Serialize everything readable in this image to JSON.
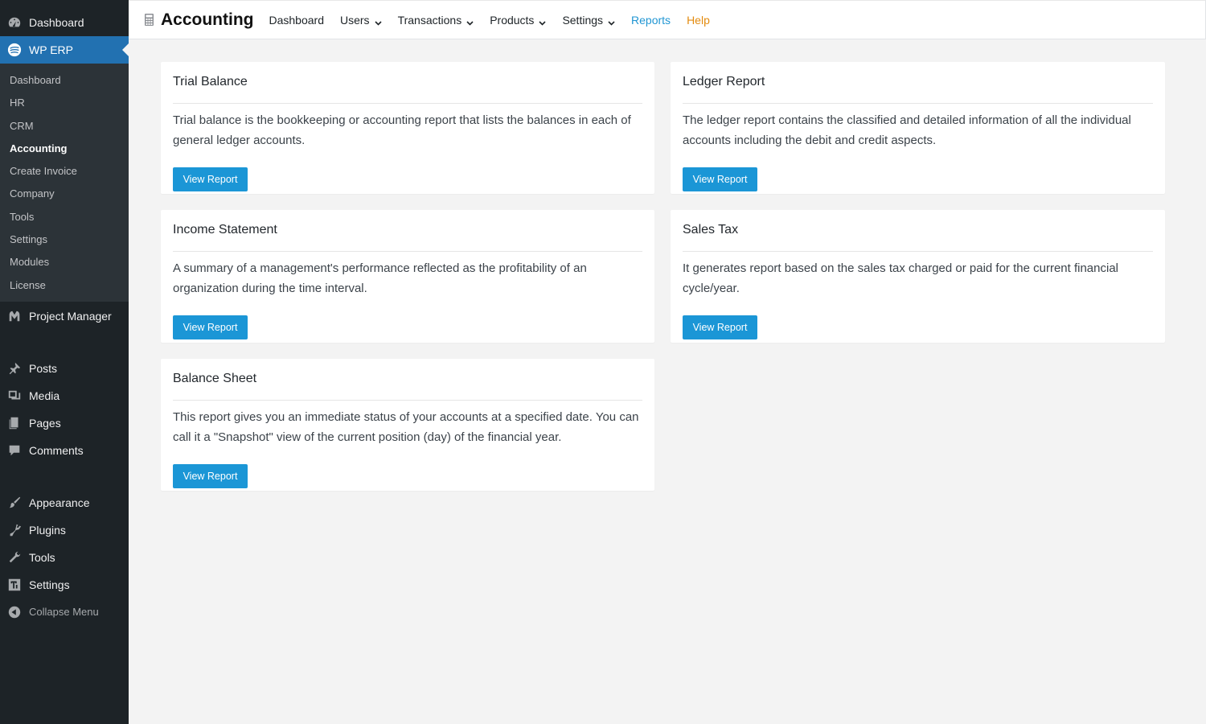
{
  "sidebar": {
    "top_items": [
      {
        "label": "Dashboard",
        "icon": "dashboard-icon"
      },
      {
        "label": "WP ERP",
        "icon": "wp-erp-icon"
      }
    ],
    "erp_submenu": [
      "Dashboard",
      "HR",
      "CRM",
      "Accounting",
      "Create Invoice",
      "Company",
      "Tools",
      "Settings",
      "Modules",
      "License"
    ],
    "erp_active": "Accounting",
    "project_manager": "Project Manager",
    "group2": [
      "Posts",
      "Media",
      "Pages",
      "Comments"
    ],
    "group3": [
      "Appearance",
      "Plugins",
      "Tools",
      "Settings"
    ],
    "collapse": "Collapse Menu"
  },
  "topbar": {
    "title": "Accounting",
    "nav": [
      {
        "label": "Dashboard",
        "dropdown": false
      },
      {
        "label": "Users",
        "dropdown": true
      },
      {
        "label": "Transactions",
        "dropdown": true
      },
      {
        "label": "Products",
        "dropdown": true
      },
      {
        "label": "Settings",
        "dropdown": true
      },
      {
        "label": "Reports",
        "dropdown": false
      },
      {
        "label": "Help",
        "dropdown": false
      }
    ],
    "reports_color": "#2196d3",
    "help_color": "#e38b0f"
  },
  "reports": [
    {
      "title": "Trial Balance",
      "description": "Trial balance is the bookkeeping or accounting report that lists the balances in each of general ledger accounts.",
      "button": "View Report"
    },
    {
      "title": "Ledger Report",
      "description": "The ledger report contains the classified and detailed information of all the individual accounts including the debit and credit aspects.",
      "button": "View Report"
    },
    {
      "title": "Income Statement",
      "description": "A summary of a management's performance reflected as the profitability of an organization during the time interval.",
      "button": "View Report"
    },
    {
      "title": "Sales Tax",
      "description": "It generates report based on the sales tax charged or paid for the current financial cycle/year.",
      "button": "View Report"
    },
    {
      "title": "Balance Sheet",
      "description": "This report gives you an immediate status of your accounts at a specified date. You can call it a \"Snapshot\" view of the current position (day) of the financial year.",
      "button": "View Report"
    }
  ],
  "colors": {
    "sidebar_bg": "#1d2327",
    "sidebar_active": "#2271b1",
    "button": "#1b96d6"
  }
}
